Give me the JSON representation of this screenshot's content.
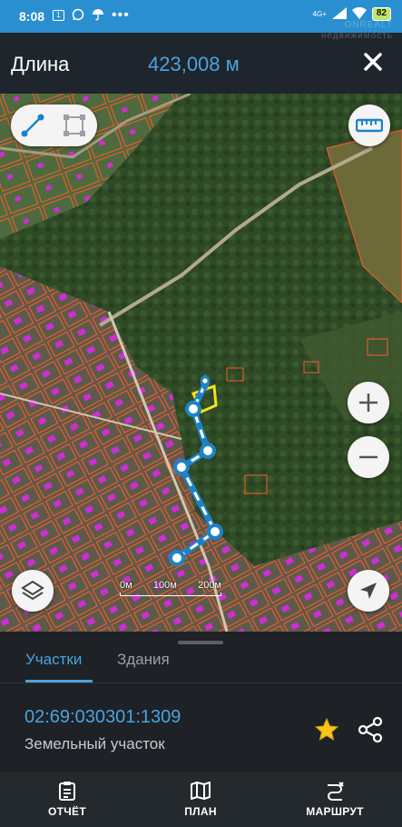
{
  "status_bar": {
    "time": "8:08",
    "notif_badge": "1",
    "network": "4G+",
    "battery": "82"
  },
  "header": {
    "title": "Длина",
    "value": "423,008 м",
    "watermark_line1": "ONREALT",
    "watermark_line2": "недвижимость"
  },
  "map": {
    "scale_labels": [
      "0м",
      "100м",
      "200м"
    ]
  },
  "sheet": {
    "tabs": [
      {
        "label": "Участки",
        "active": true
      },
      {
        "label": "Здания",
        "active": false
      }
    ],
    "cadastral_number": "02:69:030301:1309",
    "parcel_type": "Земельный участок"
  },
  "nav": {
    "items": [
      {
        "label": "ОТЧЁТ",
        "icon": "report-icon"
      },
      {
        "label": "ПЛАН",
        "icon": "map-plan-icon"
      },
      {
        "label": "МАРШРУТ",
        "icon": "route-icon"
      }
    ]
  },
  "colors": {
    "accent": "#4aa3e0",
    "status_bar": "#2a8fd0",
    "parcel_outline": "#ff5a2a",
    "building_fill": "#d02dd6",
    "measure_line": "#1d82c8",
    "selected_parcel": "#f5e21b"
  }
}
